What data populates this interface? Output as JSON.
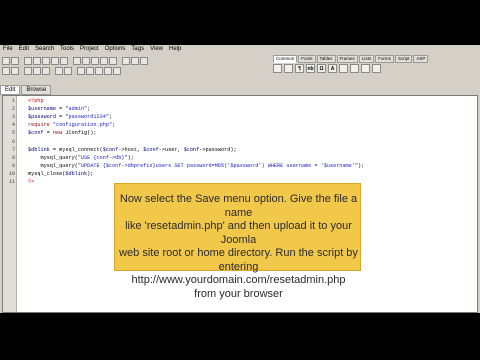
{
  "menu": [
    "File",
    "Edit",
    "Search",
    "Tools",
    "Project",
    "Options",
    "Tags",
    "View",
    "Help"
  ],
  "quick_tabs": [
    "Common",
    "Fonts",
    "Tables",
    "Frames",
    "Lists",
    "Forms",
    "Script",
    "ASP"
  ],
  "quick_buttons": [
    "¶",
    "nb",
    "Ω",
    "A"
  ],
  "edit_tabs": [
    "Edit",
    "Browse"
  ],
  "code": {
    "lines": [
      {
        "n": "1",
        "parts": [
          {
            "t": "<?php",
            "c": "tag"
          }
        ]
      },
      {
        "n": "2",
        "parts": [
          {
            "t": "$username",
            "c": "var"
          },
          {
            "t": " = ",
            "c": ""
          },
          {
            "t": "\"admin\"",
            "c": "str"
          },
          {
            "t": ";",
            "c": ""
          }
        ]
      },
      {
        "n": "3",
        "parts": [
          {
            "t": "$password",
            "c": "var"
          },
          {
            "t": " = ",
            "c": ""
          },
          {
            "t": "\"password1234\"",
            "c": "str"
          },
          {
            "t": ";",
            "c": ""
          }
        ]
      },
      {
        "n": "4",
        "parts": [
          {
            "t": "require",
            "c": "kw"
          },
          {
            "t": " ",
            "c": ""
          },
          {
            "t": "\"configuration.php\"",
            "c": "str"
          },
          {
            "t": ";",
            "c": ""
          }
        ]
      },
      {
        "n": "5",
        "parts": [
          {
            "t": "$conf",
            "c": "var"
          },
          {
            "t": " = ",
            "c": ""
          },
          {
            "t": "new",
            "c": "kw"
          },
          {
            "t": " JConfig();",
            "c": ""
          }
        ]
      },
      {
        "n": "6",
        "parts": []
      },
      {
        "n": "7",
        "parts": [
          {
            "t": "$dblink",
            "c": "var"
          },
          {
            "t": " = mysql_connect(",
            "c": ""
          },
          {
            "t": "$conf",
            "c": "var"
          },
          {
            "t": "->host, ",
            "c": ""
          },
          {
            "t": "$conf",
            "c": "var"
          },
          {
            "t": "->user, ",
            "c": ""
          },
          {
            "t": "$conf",
            "c": "var"
          },
          {
            "t": "->password);",
            "c": ""
          }
        ]
      },
      {
        "n": "8",
        "parts": [
          {
            "t": "    mysql_query(",
            "c": ""
          },
          {
            "t": "\"USE {conf->db}\"",
            "c": "str"
          },
          {
            "t": ");",
            "c": ""
          }
        ]
      },
      {
        "n": "9",
        "parts": [
          {
            "t": "    mysql_query(",
            "c": ""
          },
          {
            "t": "\"UPDATE {$conf->dbprefix}users SET password=MD5('$password') WHERE username = '$username'\"",
            "c": "str"
          },
          {
            "t": ");",
            "c": ""
          }
        ]
      },
      {
        "n": "10",
        "parts": [
          {
            "t": "mysql_close(",
            "c": ""
          },
          {
            "t": "$dblink",
            "c": "var"
          },
          {
            "t": ");",
            "c": ""
          }
        ]
      },
      {
        "n": "11",
        "parts": [
          {
            "t": "?>",
            "c": "tag"
          }
        ]
      }
    ]
  },
  "tooltip": {
    "text": "Now select the Save menu option. Give the file a name\nlike 'resetadmin.php' and then upload it to your Joomla\nweb site root or home directory.  Run the script by\nentering http://www.yourdomain.com/resetadmin.php\nfrom your browser"
  },
  "colors": {
    "tooltip_bg": "#f2c84b",
    "code_var": "#000080",
    "code_str": "#1919c8",
    "code_kw": "#8b0000",
    "code_tag": "#d10000"
  }
}
